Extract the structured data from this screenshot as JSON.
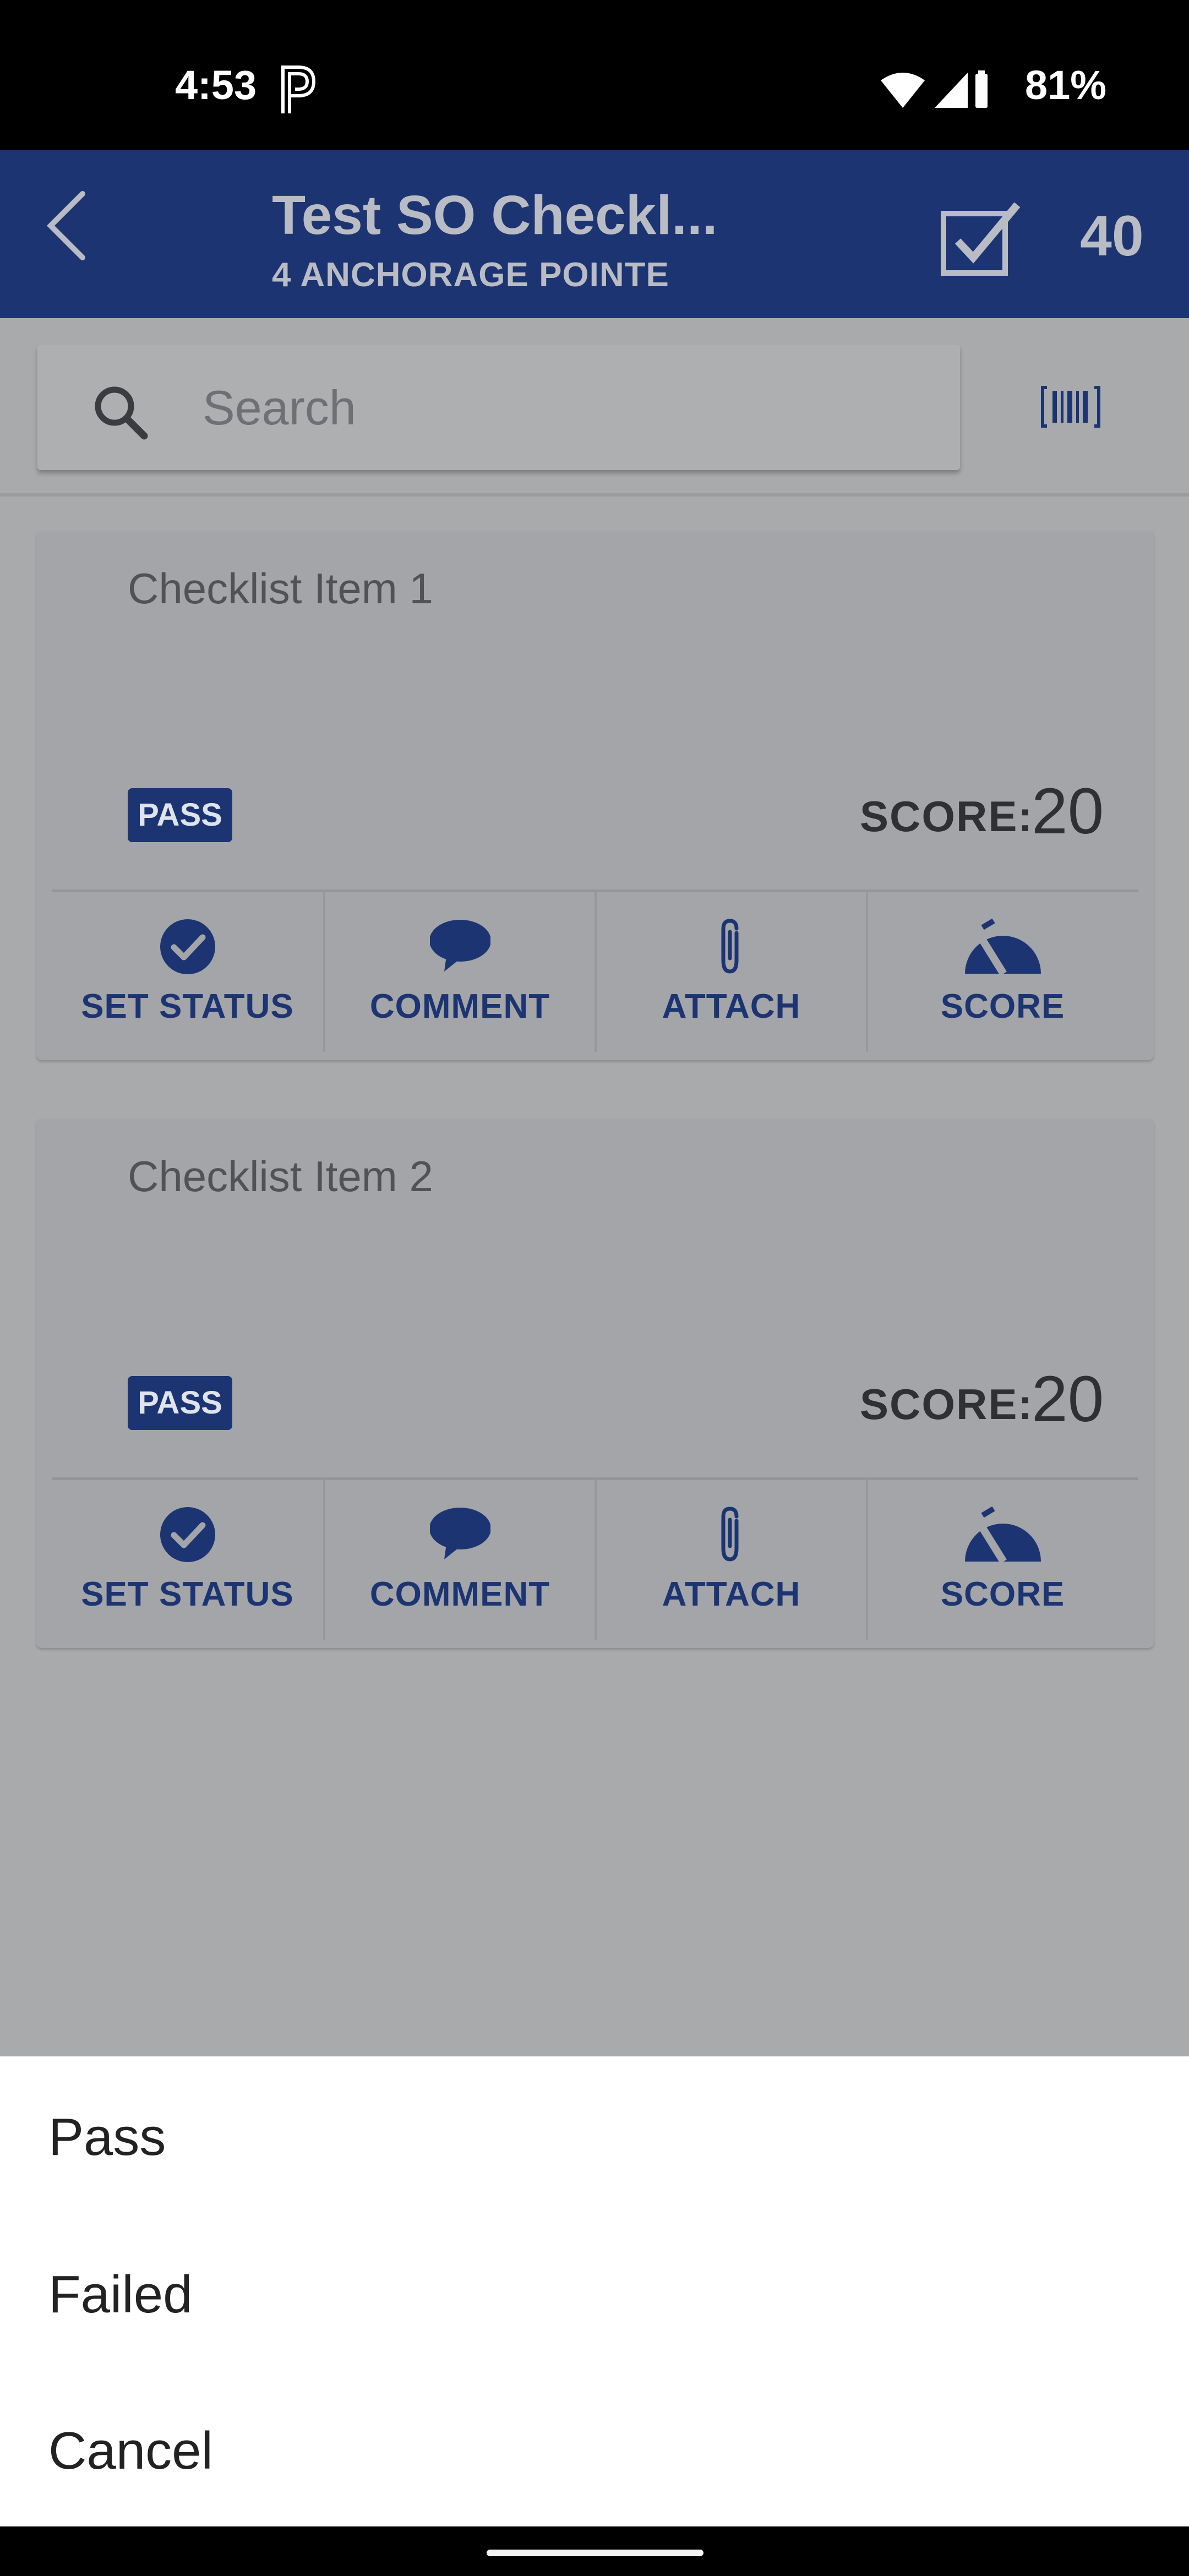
{
  "status_bar": {
    "time": "4:53",
    "battery_percent": "81%"
  },
  "app_bar": {
    "title": "Test SO Checkl...",
    "subtitle": "4 ANCHORAGE POINTE",
    "count": "40"
  },
  "search": {
    "placeholder": "Search"
  },
  "checklist_items": [
    {
      "title": "Checklist Item 1",
      "status": "PASS",
      "score_label": "SCORE:",
      "score": "20",
      "actions": {
        "set_status": "SET STATUS",
        "comment": "COMMENT",
        "attach": "ATTACH",
        "score": "SCORE"
      }
    },
    {
      "title": "Checklist Item 2",
      "status": "PASS",
      "score_label": "SCORE:",
      "score": "20",
      "actions": {
        "set_status": "SET STATUS",
        "comment": "COMMENT",
        "attach": "ATTACH",
        "score": "SCORE"
      }
    }
  ],
  "bottom_sheet": {
    "options": [
      "Pass",
      "Failed",
      "Cancel"
    ]
  },
  "colors": {
    "brand": "#1c3472",
    "scrim": "#a9aaab",
    "sheet": "#ffffff"
  }
}
